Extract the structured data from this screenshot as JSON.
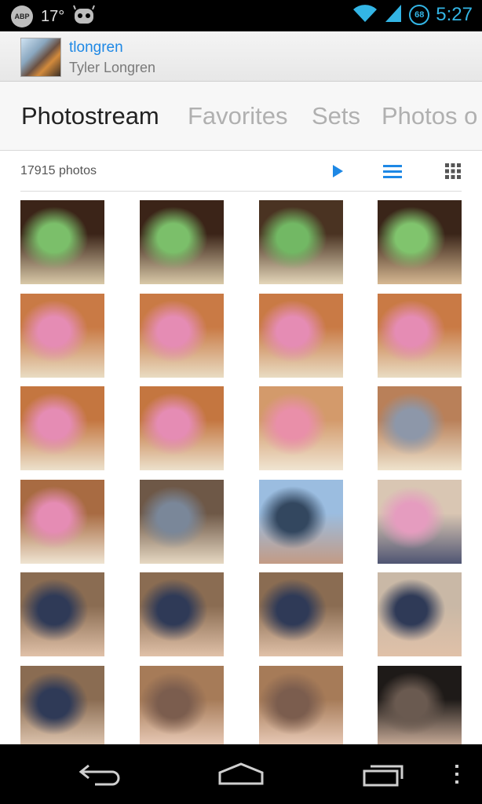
{
  "status_bar": {
    "adblock_label": "ABP",
    "temperature": "17°",
    "battery_level": "68",
    "time": "5:27",
    "icons": [
      "adblock-icon",
      "robot-icon",
      "wifi-icon",
      "signal-icon",
      "battery-icon"
    ]
  },
  "user": {
    "username": "tlongren",
    "real_name": "Tyler Longren"
  },
  "tabs": [
    {
      "label": "Photostream",
      "active": true
    },
    {
      "label": "Favorites",
      "active": false
    },
    {
      "label": "Sets",
      "active": false
    },
    {
      "label": "Photos o",
      "active": false
    }
  ],
  "toolbar": {
    "photo_count": "17915 photos",
    "accent_color": "#1e88e5",
    "buttons": [
      "play-icon",
      "list-view-icon",
      "grid-view-icon"
    ]
  },
  "photos": [
    {
      "subject": "green cones on cake",
      "colors": [
        "#3b2418",
        "#7bbf6a",
        "#d9c9a8"
      ]
    },
    {
      "subject": "green cones on cake",
      "colors": [
        "#3b2418",
        "#7bbf6a",
        "#d9c9a8"
      ]
    },
    {
      "subject": "green cones on cake",
      "colors": [
        "#4a3322",
        "#72b864",
        "#e4d6b9"
      ]
    },
    {
      "subject": "green cones on cake",
      "colors": [
        "#3a2519",
        "#80c46d",
        "#d6b892"
      ]
    },
    {
      "subject": "girl at table",
      "colors": [
        "#c97a45",
        "#e58cb4",
        "#e9dcc3"
      ]
    },
    {
      "subject": "girl at table",
      "colors": [
        "#c97a45",
        "#e58cb4",
        "#e9dcc3"
      ]
    },
    {
      "subject": "girl at table",
      "colors": [
        "#c97a45",
        "#e58cb4",
        "#e9dcc3"
      ]
    },
    {
      "subject": "girl at table",
      "colors": [
        "#c97a45",
        "#e58cb4",
        "#e9dcc3"
      ]
    },
    {
      "subject": "girl at table",
      "colors": [
        "#c47640",
        "#e58cb4",
        "#ece1cc"
      ]
    },
    {
      "subject": "girl at table",
      "colors": [
        "#c47640",
        "#e58cb4",
        "#ece1cc"
      ]
    },
    {
      "subject": "girl crafting",
      "colors": [
        "#d39a6b",
        "#e98fa9",
        "#f0e5d2"
      ]
    },
    {
      "subject": "two girls crafting",
      "colors": [
        "#b98059",
        "#8d97a9",
        "#efe3cd"
      ]
    },
    {
      "subject": "girl at table",
      "colors": [
        "#a86b42",
        "#e58cb4",
        "#efe4d2"
      ]
    },
    {
      "subject": "woman at table",
      "colors": [
        "#6e5847",
        "#7a8799",
        "#e6d8c2"
      ]
    },
    {
      "subject": "man with beanie",
      "colors": [
        "#9bbde0",
        "#33475f",
        "#c39b85"
      ]
    },
    {
      "subject": "girl on couch",
      "colors": [
        "#d9c6b3",
        "#e59cbf",
        "#4f5573"
      ]
    },
    {
      "subject": "man and girl",
      "colors": [
        "#8a6c52",
        "#2f3a57",
        "#e0c1a8"
      ]
    },
    {
      "subject": "man and girl",
      "colors": [
        "#8a6c52",
        "#2f3a57",
        "#e0c1a8"
      ]
    },
    {
      "subject": "man and girl",
      "colors": [
        "#8a6c52",
        "#2f3a57",
        "#e0c1a8"
      ]
    },
    {
      "subject": "man and girl",
      "colors": [
        "#c9b8a6",
        "#2f3a57",
        "#e0c1a8"
      ]
    },
    {
      "subject": "man and girl",
      "colors": [
        "#8a6c52",
        "#2f3a57",
        "#e6cdb7"
      ]
    },
    {
      "subject": "girl close-up",
      "colors": [
        "#a67b58",
        "#7b5d4e",
        "#efd2c0"
      ]
    },
    {
      "subject": "girl close-up",
      "colors": [
        "#a67b58",
        "#7b5d4e",
        "#efd2c0"
      ]
    },
    {
      "subject": "girl in dark",
      "colors": [
        "#1e1a18",
        "#6a5a50",
        "#d8b9a4"
      ]
    }
  ],
  "navbar": {
    "buttons": [
      "back-icon",
      "home-icon",
      "recent-apps-icon",
      "menu-icon"
    ]
  }
}
